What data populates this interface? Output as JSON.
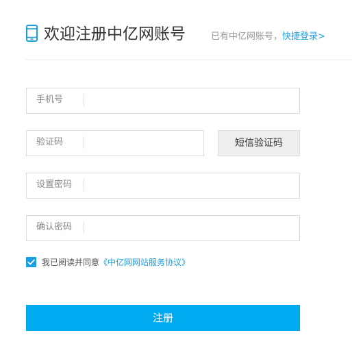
{
  "header": {
    "title": "欢迎注册中亿网账号",
    "login_prompt": "已有中亿网账号，",
    "login_link": "快捷登录>"
  },
  "form": {
    "phone": {
      "label": "手机号",
      "value": ""
    },
    "code": {
      "label": "验证码",
      "value": ""
    },
    "sms_button": "短信验证码",
    "password": {
      "label": "设置密码",
      "value": ""
    },
    "confirm": {
      "label": "确认密码",
      "value": ""
    }
  },
  "agreement": {
    "checked": true,
    "text": "我已阅读并同意",
    "link": "《中亿网网站服务协议》"
  },
  "submit_label": "注册",
  "colors": {
    "accent": "#1a9fe0",
    "button": "#00aaf0",
    "border": "#dcdcdc"
  },
  "icons": {
    "header": "mobile-phone-icon",
    "checkbox": "checkmark-icon"
  }
}
